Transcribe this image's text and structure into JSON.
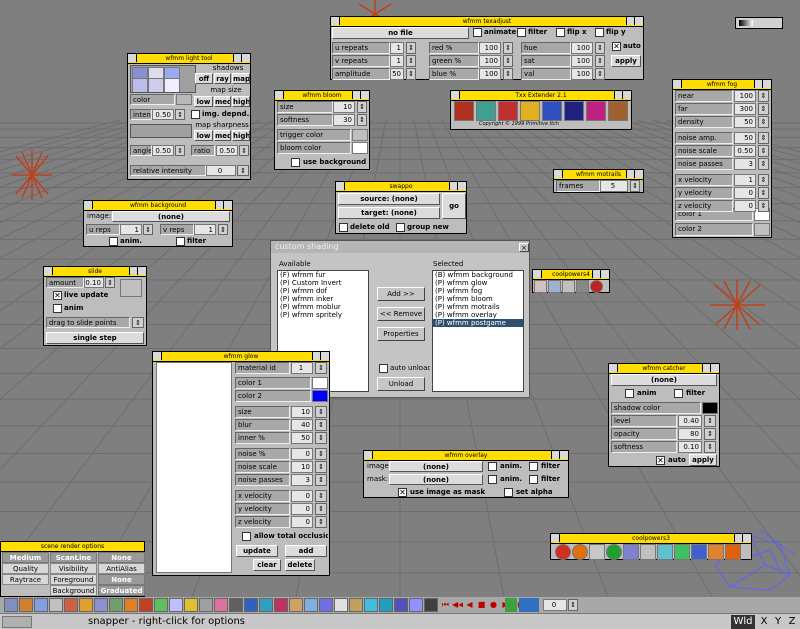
{
  "texadjust": {
    "title": "wfmm texadjust",
    "file_btn": "no file",
    "animate": "animate",
    "filter": "filter",
    "flipx": "flip x",
    "flipy": "flip y",
    "rows": [
      {
        "l": "u repeats",
        "v": "1",
        "c": "red %",
        "cv": "100",
        "h": "hue",
        "hv": "100"
      },
      {
        "l": "v repeats",
        "v": "1",
        "c": "green %",
        "cv": "100",
        "h": "sat",
        "hv": "100"
      },
      {
        "l": "amplitude",
        "v": "50",
        "c": "blue %",
        "cv": "100",
        "h": "val",
        "hv": "100"
      }
    ],
    "auto": "auto",
    "apply": "apply"
  },
  "lighttool": {
    "title": "wfmm light tool",
    "shadows": "shadows",
    "off": "off",
    "ray": "ray",
    "map": "map",
    "color": "color",
    "mapsize": "map size",
    "low": "low",
    "med": "med",
    "high": "high",
    "intens": "intens",
    "intens_v": "0.50",
    "imgdepnd": "img. depnd.",
    "mapsharp": "map sharpness",
    "angle": "angle",
    "angle_v": "0.50",
    "ratio": "ratio",
    "ratio_v": "0.50",
    "relint": "relative intensity",
    "relint_v": "0"
  },
  "bloom": {
    "title": "wfmm bloom",
    "size": "size",
    "size_v": "10",
    "soft": "softness",
    "soft_v": "30",
    "trig": "trigger color",
    "bloomc": "bloom color",
    "usebg": "use background"
  },
  "txx": {
    "title": "Txx Extender 2.1",
    "copy": "Copyright © 1999 Primitive Itch"
  },
  "fog": {
    "title": "wfmm fog",
    "rows": [
      {
        "l": "near",
        "v": "100"
      },
      {
        "l": "far",
        "v": "300"
      },
      {
        "l": "density",
        "v": "50"
      },
      {
        "l": "noise amp.",
        "v": "50"
      },
      {
        "l": "noise scale",
        "v": "0.50"
      },
      {
        "l": "noise passes",
        "v": "3"
      },
      {
        "l": "x velocity",
        "v": "1"
      },
      {
        "l": "y velocity",
        "v": "0"
      },
      {
        "l": "z velocity",
        "v": "0"
      }
    ],
    "c1": "color 1",
    "c2": "color 2"
  },
  "motrails": {
    "title": "wfmm motrails",
    "frames": "frames",
    "frames_v": "5"
  },
  "swappo": {
    "title": "swappo",
    "source": "source: (none)",
    "target": "target: (none)",
    "go": "go",
    "delold": "delete old",
    "grpnew": "group new"
  },
  "background": {
    "title": "wfmm background",
    "image": "image:",
    "none": "(none)",
    "ureps": "u reps",
    "ureps_v": "1",
    "vreps": "v reps",
    "vreps_v": "1",
    "anim": "anim.",
    "filter": "filter"
  },
  "shading": {
    "title": "custom shading",
    "close": "×",
    "available": "Available",
    "selected": "Selected",
    "avail": [
      "(F) wfmm fur",
      "(P) Custom Invert",
      "(P) wfmm dof",
      "(P) wfmm inker",
      "(P) wfmm moblur",
      "(P) wfmm spritely"
    ],
    "sel": [
      "(B) wfmm background",
      "(P) wfmm glow",
      "(P) wfmm fog",
      "(P) wfmm bloom",
      "(P) wfmm motrails",
      "(P) wfmm overlay",
      "(P) wfmm postgame"
    ],
    "add": "Add >>",
    "remove": "<< Remove",
    "props": "Properties",
    "autounload": "auto unload",
    "unload": "Unload"
  },
  "slide": {
    "title": "slide",
    "amount": "amount",
    "amount_v": "0.10",
    "live": "live update",
    "anim": "anim",
    "drag": "drag to slide points",
    "single": "single step"
  },
  "coolpowers4": {
    "title": "coolpowers4"
  },
  "glow": {
    "title": "wfmm glow",
    "matid": "material id",
    "matid_v": "1",
    "c1": "color 1",
    "c2": "color 2",
    "rows": [
      {
        "l": "size",
        "v": "10"
      },
      {
        "l": "blur",
        "v": "40"
      },
      {
        "l": "inner %",
        "v": "50"
      },
      {
        "l": "noise %",
        "v": "0"
      },
      {
        "l": "noise scale",
        "v": "10"
      },
      {
        "l": "noise passes",
        "v": "3"
      },
      {
        "l": "x velocity",
        "v": "0"
      },
      {
        "l": "y velocity",
        "v": "0"
      },
      {
        "l": "z velocity",
        "v": "0"
      }
    ],
    "occl": "allow total occlusion",
    "update": "update",
    "add": "add",
    "clear": "clear",
    "delete": "delete"
  },
  "catcher": {
    "title": "wfmm catcher",
    "none": "(none)",
    "anim": "anim",
    "filter": "filter",
    "shadow": "shadow color",
    "level": "level",
    "level_v": "0.40",
    "opacity": "opacity",
    "opacity_v": "80",
    "softness": "softness",
    "softness_v": "0.10",
    "auto": "auto",
    "apply": "apply"
  },
  "overlay": {
    "title": "wfmm overlay",
    "image": "image:",
    "mask": "mask:",
    "none": "(none)",
    "anim": "anim.",
    "filter": "filter",
    "usemask": "use image as mask",
    "alpha": "set alpha"
  },
  "coolpowers3": {
    "title": "coolpowers3"
  },
  "render": {
    "title": "scene render options",
    "cells": [
      [
        "Medium",
        "ScanLine",
        "None"
      ],
      [
        "Quality",
        "Visibility",
        "AntiAlias"
      ],
      [
        "Raytrace",
        "Foreground",
        "None"
      ],
      [
        "",
        "Background",
        "Graduated"
      ]
    ]
  },
  "status": {
    "text": "snapper - right-click for options",
    "frame": "0",
    "views": [
      "Wld",
      "X",
      "Y",
      "Z"
    ]
  }
}
